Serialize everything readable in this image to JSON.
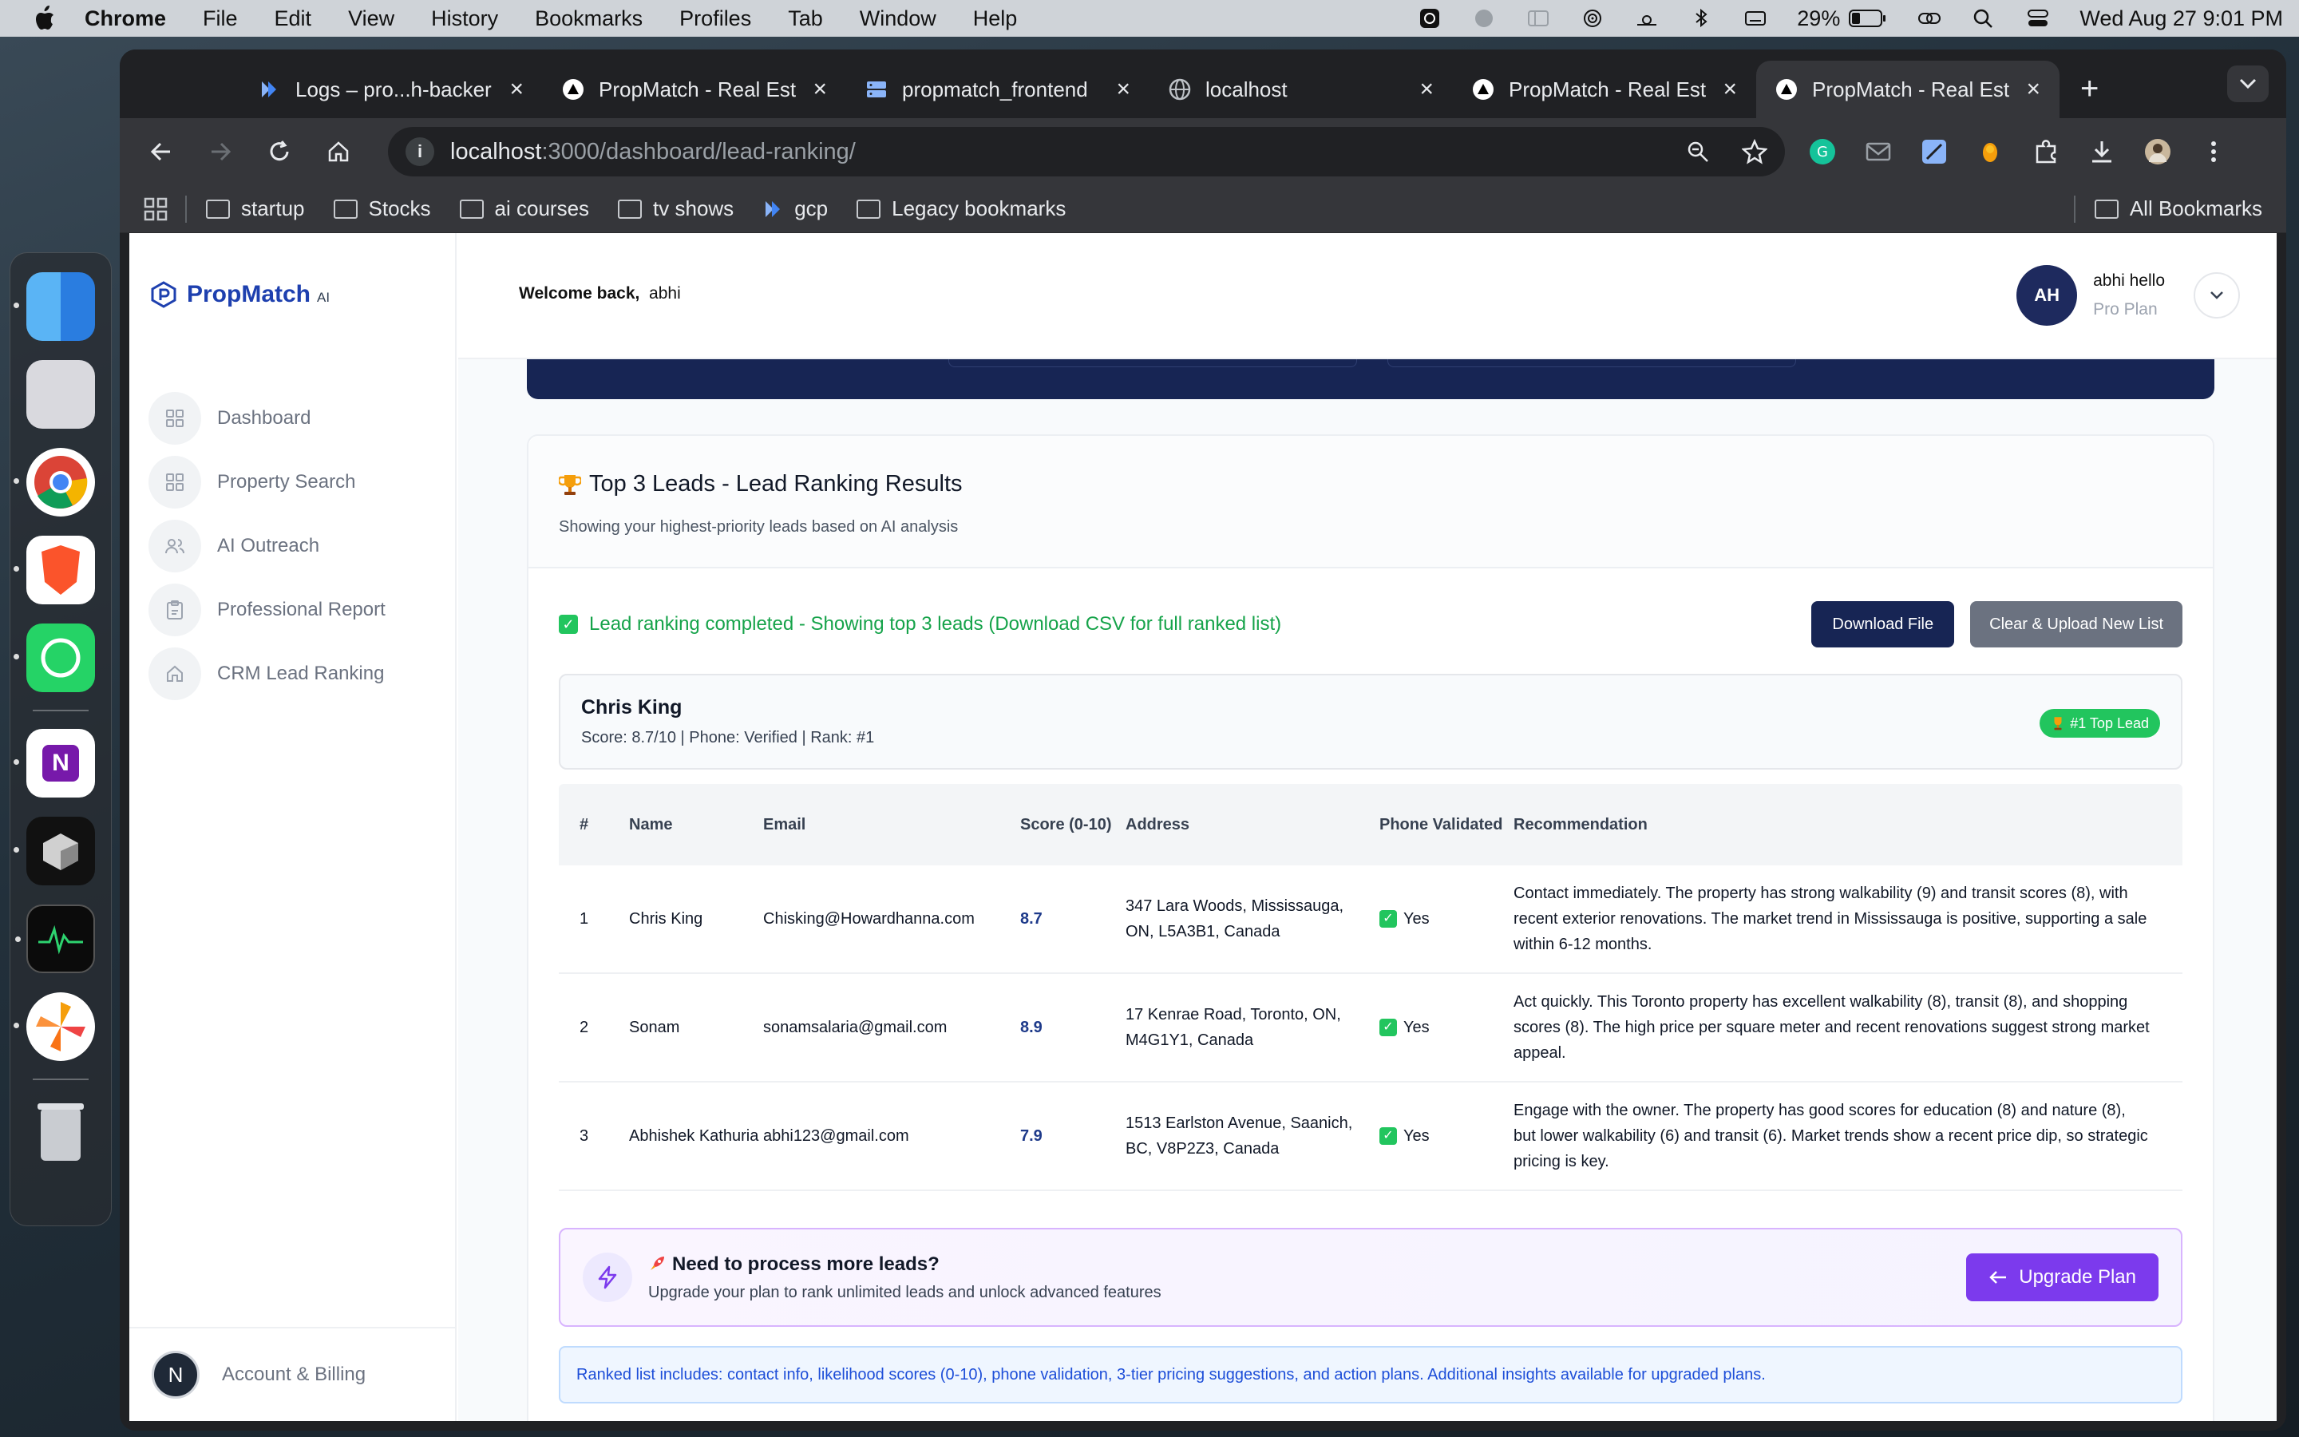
{
  "menubar": {
    "app": "Chrome",
    "items": [
      "File",
      "Edit",
      "View",
      "History",
      "Bookmarks",
      "Profiles",
      "Tab",
      "Window",
      "Help"
    ],
    "battery": "29%",
    "datetime": "Wed Aug 27  9:01 PM"
  },
  "tabs": [
    {
      "title": "Logs – pro...h-backer",
      "icon": "cloud-run-icon",
      "active": false
    },
    {
      "title": "PropMatch - Real Est",
      "icon": "vercel-icon",
      "active": false
    },
    {
      "title": "propmatch_frontend",
      "icon": "server-icon",
      "active": false
    },
    {
      "title": "localhost",
      "icon": "globe-icon",
      "active": false
    },
    {
      "title": "PropMatch - Real Est",
      "icon": "vercel-icon",
      "active": false
    },
    {
      "title": "PropMatch - Real Est",
      "icon": "vercel-icon",
      "active": true
    }
  ],
  "omnibox": {
    "host": "localhost",
    "path": ":3000/dashboard/lead-ranking/"
  },
  "bookmarks": {
    "items": [
      "startup",
      "Stocks",
      "ai courses",
      "tv shows",
      "gcp",
      "Legacy bookmarks"
    ],
    "all": "All Bookmarks"
  },
  "sidebar": {
    "brand": "PropMatch",
    "brand_suffix": "AI",
    "items": [
      {
        "label": "Dashboard",
        "icon": "grid-icon"
      },
      {
        "label": "Property Search",
        "icon": "grid-icon"
      },
      {
        "label": "AI Outreach",
        "icon": "users-icon"
      },
      {
        "label": "Professional Report",
        "icon": "clipboard-icon"
      },
      {
        "label": "CRM Lead Ranking",
        "icon": "home-icon"
      }
    ],
    "account_label": "Account & Billing",
    "account_initial": "N"
  },
  "topbar": {
    "welcome": "Welcome back,",
    "username": "abhi",
    "user_initials": "AH",
    "user_display": "abhi hello",
    "plan": "Pro Plan"
  },
  "results": {
    "title": "Top 3 Leads - Lead Ranking Results",
    "subtitle": "Showing your highest-priority leads based on AI analysis",
    "status": "Lead ranking completed - Showing top 3 leads (Download CSV for full ranked list)",
    "download_label": "Download File",
    "clear_label": "Clear & Upload New List",
    "top_lead": {
      "name": "Chris King",
      "meta": "Score: 8.7/10 | Phone: Verified | Rank: #1",
      "badge": "#1 Top Lead"
    },
    "columns": {
      "num": "#",
      "name": "Name",
      "email": "Email",
      "score": "Score (0-10)",
      "address": "Address",
      "phone": "Phone Validated",
      "rec": "Recommendation"
    },
    "rows": [
      {
        "num": "1",
        "name": "Chris King",
        "email": "Chisking@Howardhanna.com",
        "score": "8.7",
        "address": "347 Lara Woods, Mississauga, ON, L5A3B1, Canada",
        "phone": "Yes",
        "rec": "Contact immediately. The property has strong walkability (9) and transit scores (8), with recent exterior renovations. The market trend in Mississauga is positive, supporting a sale within 6-12 months."
      },
      {
        "num": "2",
        "name": "Sonam",
        "email": "sonamsalaria@gmail.com",
        "score": "8.9",
        "address": "17 Kenrae Road, Toronto, ON, M4G1Y1, Canada",
        "phone": "Yes",
        "rec": "Act quickly. This Toronto property has excellent walkability (8), transit (8), and shopping scores (8). The high price per square meter and recent renovations suggest strong market appeal."
      },
      {
        "num": "3",
        "name": "Abhishek Kathuria",
        "email": "abhi123@gmail.com",
        "score": "7.9",
        "address": "1513 Earlston Avenue, Saanich, BC, V8P2Z3, Canada",
        "phone": "Yes",
        "rec": "Engage with the owner. The property has good scores for education (8) and nature (8), but lower walkability (6) and transit (6). Market trends show a recent price dip, so strategic pricing is key."
      }
    ],
    "upgrade": {
      "title": "Need to process more leads?",
      "subtitle": "Upgrade your plan to rank unlimited leads and unlock advanced features",
      "button": "Upgrade Plan"
    },
    "info": "Ranked list includes: contact info, likelihood scores (0-10), phone validation, 3-tier pricing suggestions, and action plans. Additional insights available for upgraded plans."
  },
  "colors": {
    "navy": "#172554",
    "green": "#16a34a",
    "purple": "#7c3aed",
    "brand_blue": "#1e40af"
  }
}
